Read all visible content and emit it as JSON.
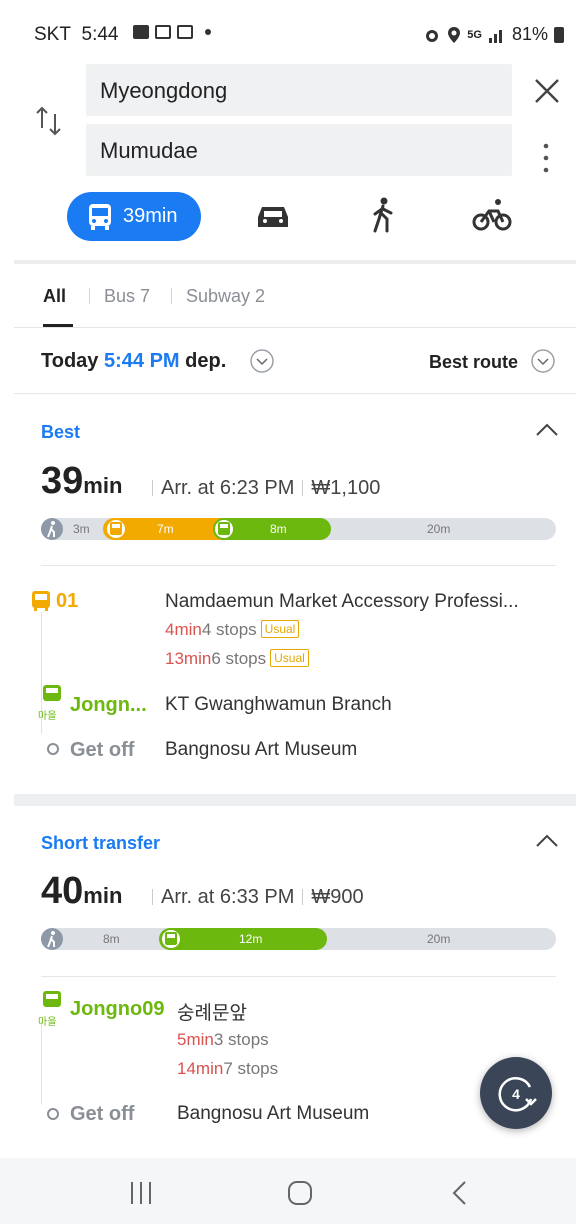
{
  "status": {
    "carrier": "SKT",
    "time": "5:44",
    "network": "5G",
    "battery": "81%"
  },
  "search": {
    "from": "Myeongdong",
    "to": "Mumudae"
  },
  "modes": {
    "bus_time": "39min"
  },
  "filters": {
    "all": "All",
    "bus": "Bus 7",
    "subway": "Subway 2"
  },
  "departure": {
    "today": "Today",
    "time": "5:44 PM",
    "suffix": "dep.",
    "sort": "Best route"
  },
  "routes": [
    {
      "title": "Best",
      "duration": "39",
      "duration_unit": "min",
      "arrival": "Arr. at 6:23 PM",
      "fare": "₩1,100",
      "bar": {
        "walk": "3m",
        "seg1": "7m",
        "seg2": "8m",
        "rest": "20m"
      },
      "steps": [
        {
          "code": "01",
          "color": "#f2a900",
          "stop": "Namdaemun Market Accessory Professi...",
          "times": [
            {
              "min": "4min",
              "stops": "4 stops",
              "badge": "Usual"
            },
            {
              "min": "13min",
              "stops": "6 stops",
              "badge": "Usual"
            }
          ]
        },
        {
          "code": "Jongn...",
          "color": "#6cb80f",
          "badge": "마을",
          "stop": "KT Gwanghwamun Branch"
        }
      ],
      "getoff_label": "Get off",
      "getoff_stop": "Bangnosu Art Museum"
    },
    {
      "title": "Short transfer",
      "duration": "40",
      "duration_unit": "min",
      "arrival": "Arr. at 6:33 PM",
      "fare": "₩900",
      "bar": {
        "walk": "8m",
        "seg1": "12m",
        "rest": "20m"
      },
      "steps": [
        {
          "code": "Jongno09",
          "color": "#6cb80f",
          "badge": "마을",
          "stop": "숭례문앞",
          "times": [
            {
              "min": "5min",
              "stops": "3 stops"
            },
            {
              "min": "14min",
              "stops": "7 stops"
            }
          ]
        }
      ],
      "getoff_label": "Get off",
      "getoff_stop": "Bangnosu Art Museum"
    }
  ],
  "fab": {
    "count": "4"
  },
  "colors": {
    "accent": "#1a7bf3",
    "bus_yellow": "#f2a900",
    "bus_green": "#6cb80f",
    "time_red": "#d9534f"
  }
}
